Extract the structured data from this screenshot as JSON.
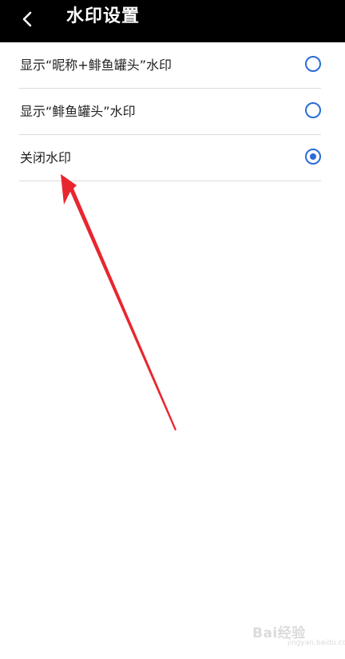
{
  "header": {
    "title": "水印设置",
    "back_icon": "chevron-left-icon"
  },
  "options": [
    {
      "label": "显示“昵称+鲱鱼罐头”水印",
      "selected": false
    },
    {
      "label": "显示“鲱鱼罐头”水印",
      "selected": false
    },
    {
      "label": "关闭水印",
      "selected": true
    }
  ],
  "colors": {
    "header_bg": "#000000",
    "accent": "#2a6bd8",
    "annotation": "#e8262f"
  },
  "watermark": {
    "brand": "Bai经验",
    "domain": "jingyan.baidu.com"
  }
}
